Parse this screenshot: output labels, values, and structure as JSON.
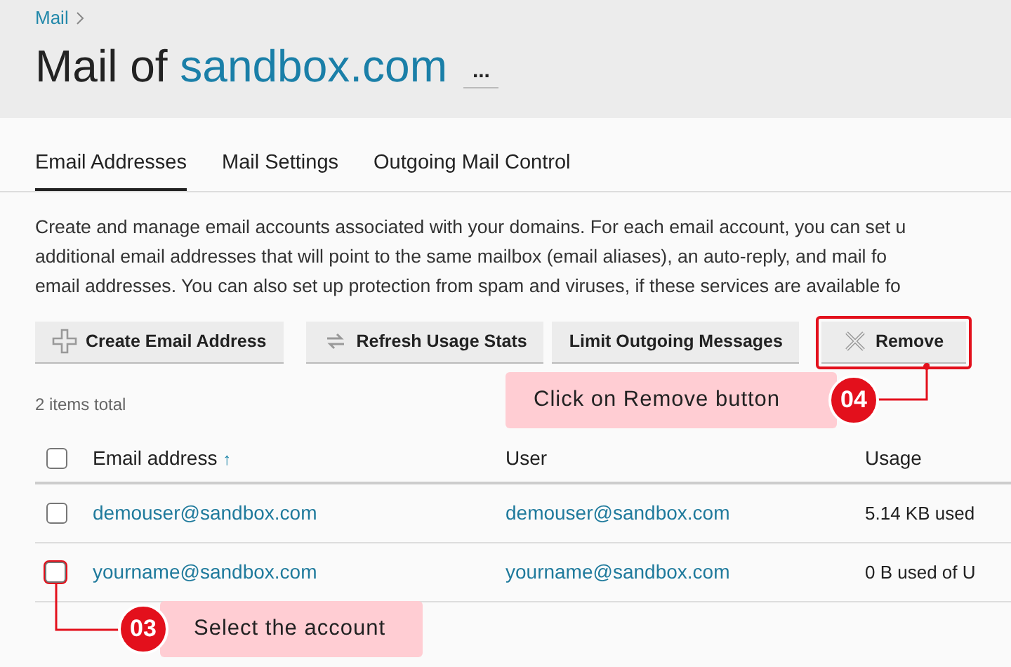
{
  "breadcrumb": {
    "items": [
      "Mail"
    ]
  },
  "title": {
    "prefix": "Mail of",
    "domain": "sandbox.com",
    "more": "..."
  },
  "tabs": [
    {
      "label": "Email Addresses",
      "selected": true
    },
    {
      "label": "Mail Settings",
      "selected": false
    },
    {
      "label": "Outgoing Mail Control",
      "selected": false
    }
  ],
  "description": [
    "Create and manage email accounts associated with your domains. For each email account, you can set u",
    "additional email addresses that will point to the same mailbox (email aliases), an auto-reply, and mail fo",
    "email addresses. You can also set up protection from spam and viruses, if these services are available fo"
  ],
  "toolbar": [
    {
      "label": "Create Email Address",
      "kind": "plus",
      "highlighted": false
    },
    {
      "label": "Refresh Usage Stats",
      "kind": "refresh",
      "highlighted": false
    },
    {
      "label": "Limit Outgoing Messages",
      "kind": "none",
      "highlighted": false
    },
    {
      "label": "Remove",
      "kind": "remove",
      "highlighted": true
    }
  ],
  "items_total": "2 items total",
  "table": {
    "columns": [
      "Email address",
      "User",
      "Usage"
    ],
    "sort_indicator": "↑",
    "header_checked": false,
    "rows": [
      {
        "email": "demouser@sandbox.com",
        "user": "demouser@sandbox.com",
        "usage": "5.14 KB used",
        "checked": false,
        "highlighted": false
      },
      {
        "email": "yourname@sandbox.com",
        "user": "yourname@sandbox.com",
        "usage": "0 B used of U",
        "checked": false,
        "highlighted": true
      }
    ]
  },
  "callouts": [
    {
      "number": "04",
      "text": "Click on Remove button"
    },
    {
      "number": "03",
      "text": "Select the account"
    }
  ]
}
